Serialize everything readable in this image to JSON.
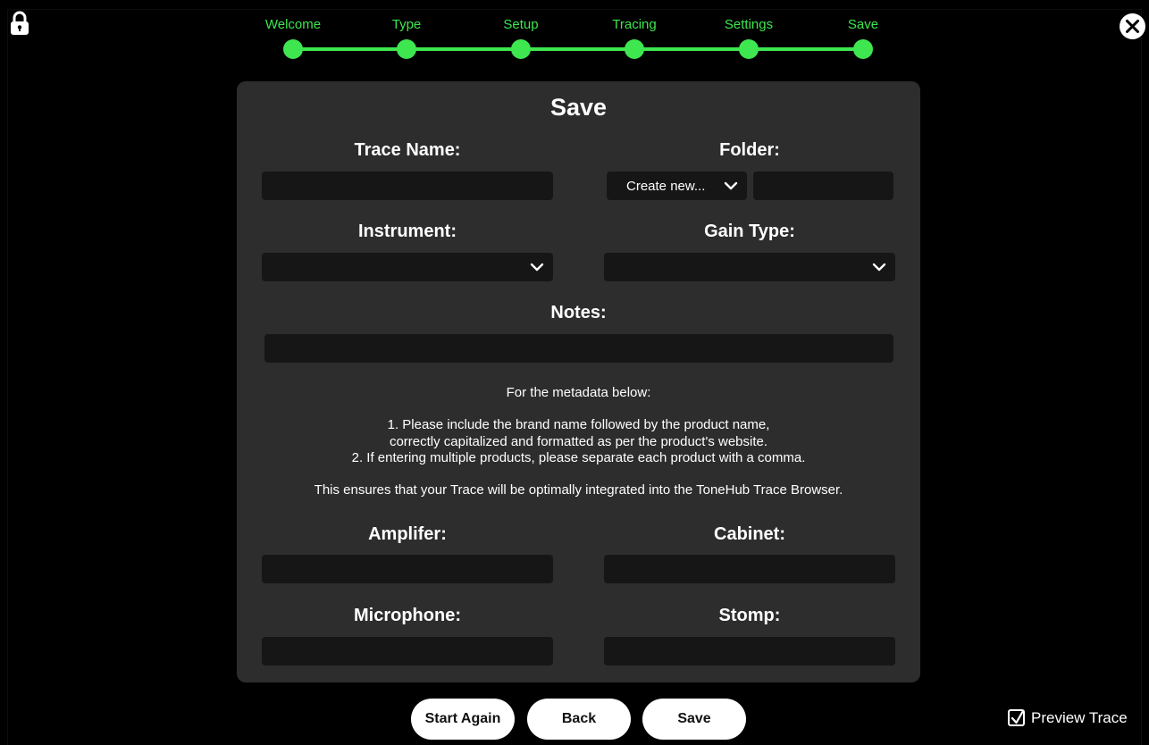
{
  "stepper": {
    "steps": [
      {
        "label": "Welcome"
      },
      {
        "label": "Type"
      },
      {
        "label": "Setup"
      },
      {
        "label": "Tracing"
      },
      {
        "label": "Settings"
      },
      {
        "label": "Save"
      }
    ],
    "active_color": "#3ee64f"
  },
  "icons": {
    "lock": "lock-icon",
    "close": "close-icon",
    "dropdown": "chevron-down-icon",
    "check": "checkmark-icon"
  },
  "panel": {
    "title": "Save",
    "trace_name": {
      "label": "Trace Name:",
      "value": ""
    },
    "folder": {
      "label": "Folder:",
      "selected": "Create new...",
      "new_name_value": ""
    },
    "instrument": {
      "label": "Instrument:",
      "selected": ""
    },
    "gain_type": {
      "label": "Gain Type:",
      "selected": ""
    },
    "notes": {
      "label": "Notes:",
      "value": ""
    },
    "info": {
      "intro": "For the metadata below:",
      "line1": "1. Please include the brand name followed by the product name,",
      "line2": "correctly capitalized and formatted as per the product's website.",
      "line3": "2. If entering multiple products, please separate each product with a comma.",
      "outro": "This ensures that your Trace will be optimally integrated into the ToneHub Trace Browser."
    },
    "amplifier": {
      "label": "Amplifer:",
      "value": ""
    },
    "cabinet": {
      "label": "Cabinet:",
      "value": ""
    },
    "microphone": {
      "label": "Microphone:",
      "value": ""
    },
    "stomp": {
      "label": "Stomp:",
      "value": ""
    }
  },
  "footer": {
    "start_again": "Start Again",
    "back": "Back",
    "save": "Save",
    "preview_trace": {
      "label": "Preview Trace",
      "checked": true
    }
  },
  "colors": {
    "background": "#000000",
    "panel": "#2d2d2d",
    "field": "#161616",
    "accent": "#3ee64f"
  }
}
